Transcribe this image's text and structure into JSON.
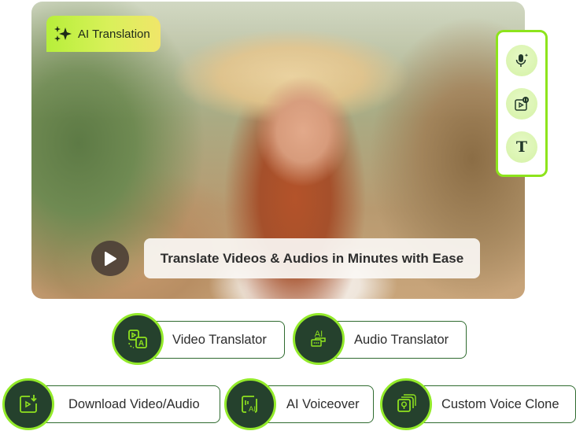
{
  "hero": {
    "badge_icon": "sparkles-icon",
    "badge_label": "AI Translation",
    "caption": "Translate Videos & Audios in Minutes with Ease",
    "play_icon": "play-icon"
  },
  "side_panel": {
    "items": [
      {
        "icon": "ai-microphone-icon"
      },
      {
        "icon": "video-translate-icon"
      },
      {
        "icon": "text-icon",
        "glyph": "T"
      }
    ]
  },
  "features": [
    {
      "label": "Video Translator",
      "icon": "video-translator-icon"
    },
    {
      "label": "Audio Translator",
      "icon": "audio-translator-icon",
      "icon_text": "AI"
    },
    {
      "label": "Download Video/Audio",
      "icon": "download-video-icon"
    },
    {
      "label": "AI Voiceover",
      "icon": "ai-voiceover-icon",
      "icon_text": "AI"
    },
    {
      "label": "Custom Voice Clone",
      "icon": "voice-clone-icon"
    }
  ],
  "colors": {
    "accent_lime": "#93ea2a",
    "dark_green": "#25412d",
    "pill_border": "#2f6b2f",
    "icon_lime": "#8fe21f"
  }
}
